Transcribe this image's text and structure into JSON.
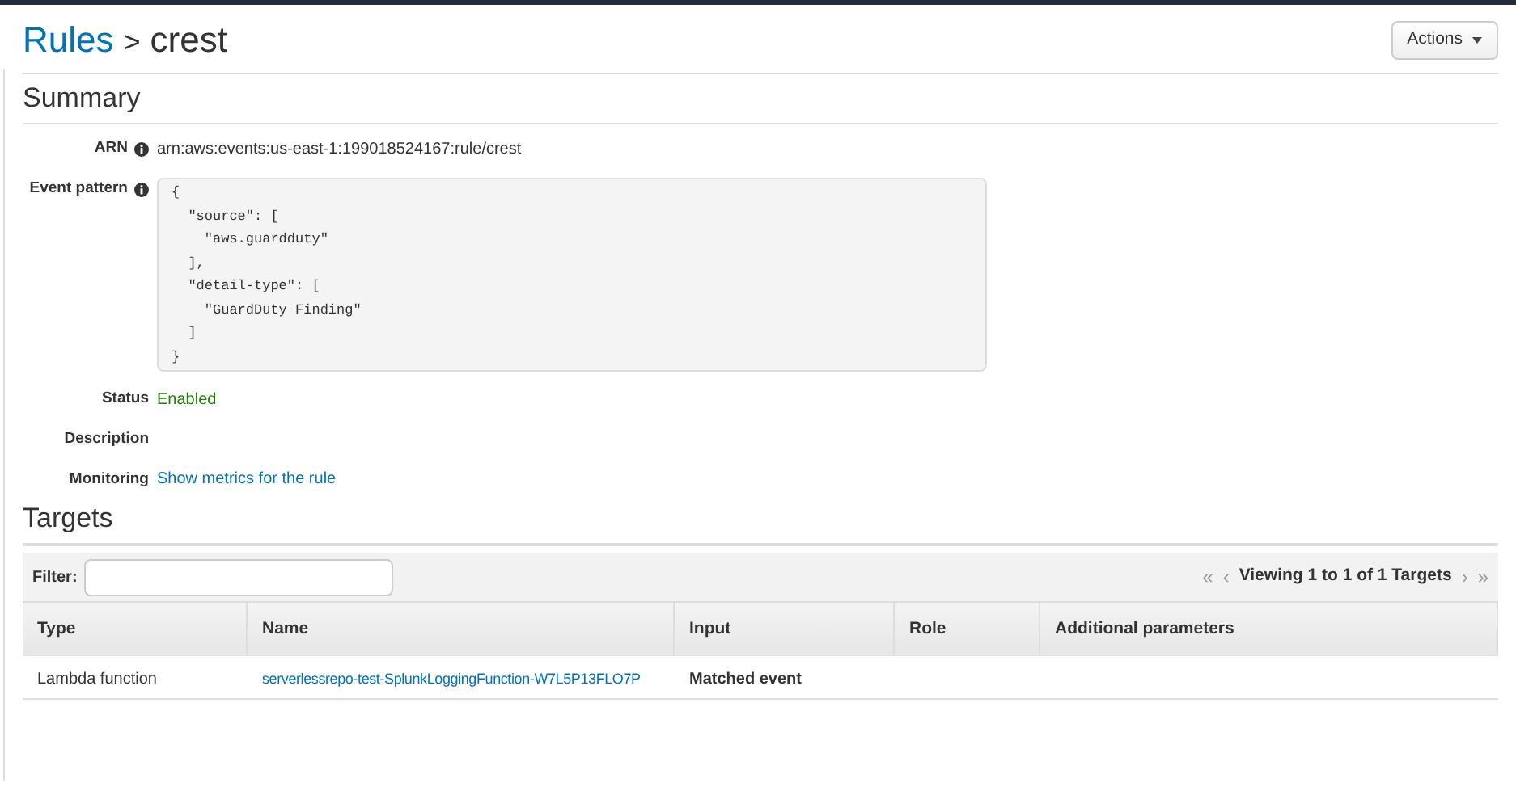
{
  "breadcrumb": {
    "parent": "Rules",
    "separator": ">",
    "current": "crest"
  },
  "actions_button": {
    "label": "Actions"
  },
  "summary": {
    "title": "Summary",
    "fields": [
      {
        "kind": "text",
        "label": "ARN",
        "info": true,
        "value": "arn:aws:events:us-east-1:199018524167:rule/crest"
      },
      {
        "kind": "code",
        "label": "Event pattern",
        "info": true,
        "lines": [
          "{",
          "  \"source\": [",
          "    \"aws.guardduty\"",
          "  ],",
          "  \"detail-type\": [",
          "    \"GuardDuty Finding\"",
          "  ]",
          "}"
        ]
      },
      {
        "kind": "status",
        "label": "Status",
        "info": false,
        "value": "Enabled"
      },
      {
        "kind": "text",
        "label": "Description",
        "info": false
      },
      {
        "kind": "link",
        "label": "Monitoring",
        "info": false,
        "value": "Show metrics for the rule"
      }
    ]
  },
  "targets": {
    "title": "Targets",
    "filter_label": "Filter:",
    "pager": "Viewing 1 to 1 of 1 Targets",
    "pager_first": "«",
    "pager_prev": "‹",
    "pager_next": "›",
    "pager_last": "»",
    "columns": [
      "Type",
      "Name",
      "Input",
      "Role",
      "Additional parameters"
    ],
    "rows": [
      {
        "type": "Lambda function",
        "name": "serverlessrepo-test-SplunkLoggingFunction-W7L5P13FLO7P",
        "input": "Matched event"
      }
    ]
  }
}
